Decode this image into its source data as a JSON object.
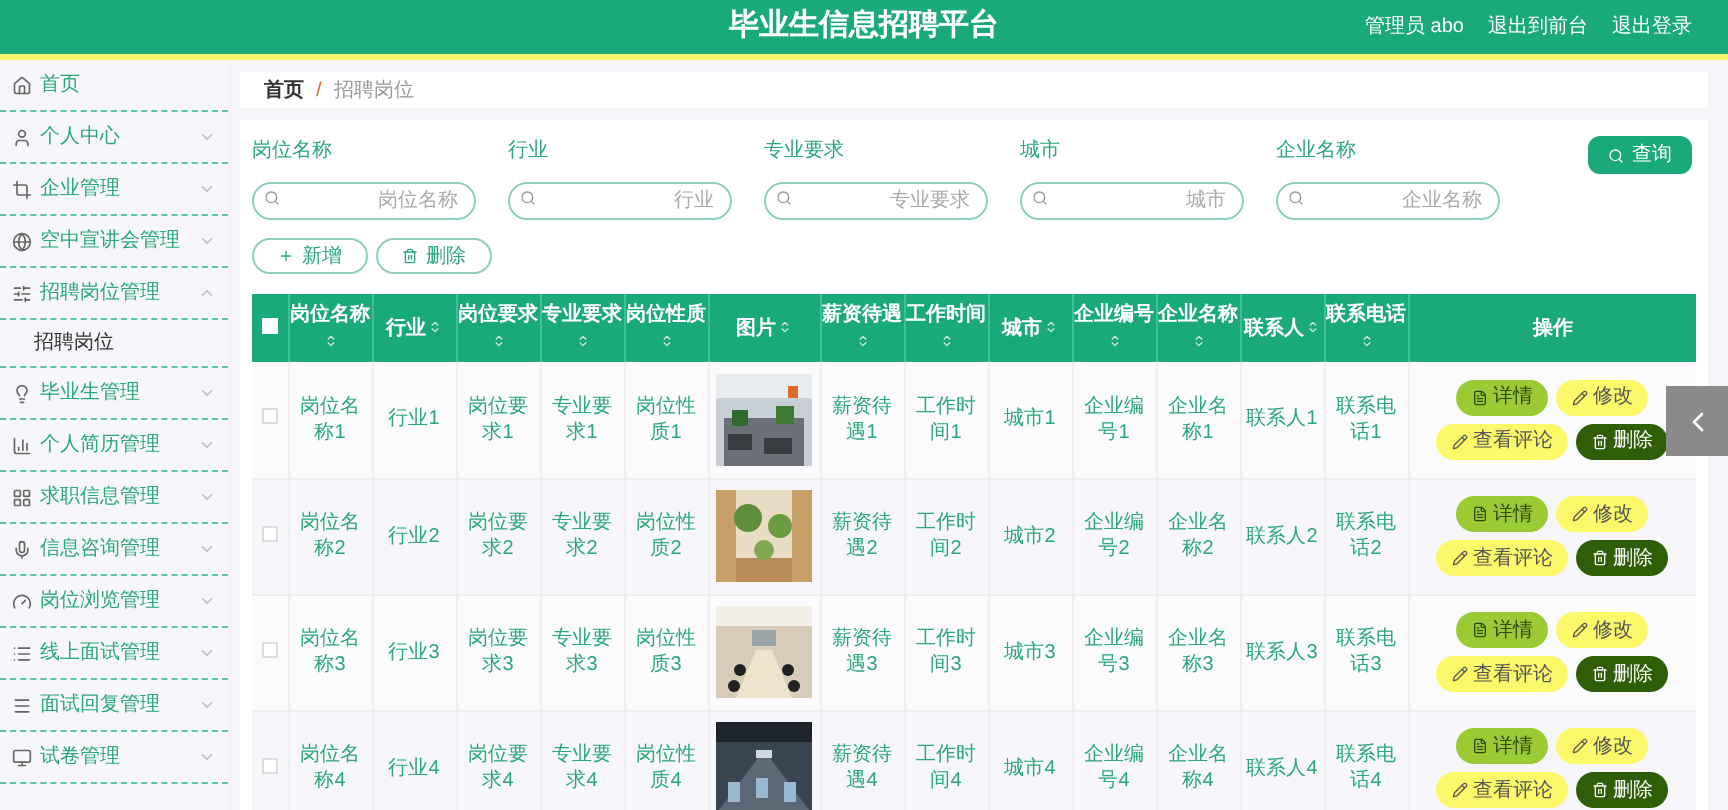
{
  "header": {
    "title": "毕业生信息招聘平台",
    "links": [
      "管理员 abo",
      "退出到前台",
      "退出登录"
    ]
  },
  "sidebar": {
    "items": [
      {
        "label": "首页",
        "kind": "link"
      },
      {
        "label": "个人中心",
        "kind": "menu",
        "expanded": false
      },
      {
        "label": "企业管理",
        "kind": "menu",
        "expanded": false
      },
      {
        "label": "空中宣讲会管理",
        "kind": "menu",
        "expanded": false
      },
      {
        "label": "招聘岗位管理",
        "kind": "menu",
        "expanded": true,
        "children": [
          {
            "label": "招聘岗位"
          }
        ]
      },
      {
        "label": "毕业生管理",
        "kind": "menu",
        "expanded": false
      },
      {
        "label": "个人简历管理",
        "kind": "menu",
        "expanded": false
      },
      {
        "label": "求职信息管理",
        "kind": "menu",
        "expanded": false
      },
      {
        "label": "信息咨询管理",
        "kind": "menu",
        "expanded": false
      },
      {
        "label": "岗位浏览管理",
        "kind": "menu",
        "expanded": false
      },
      {
        "label": "线上面试管理",
        "kind": "menu",
        "expanded": false
      },
      {
        "label": "面试回复管理",
        "kind": "menu",
        "expanded": false
      },
      {
        "label": "试卷管理",
        "kind": "menu",
        "expanded": false
      }
    ]
  },
  "breadcrumb": {
    "items": [
      "首页",
      "招聘岗位"
    ],
    "separator": "/"
  },
  "search": {
    "fields": [
      {
        "label": "岗位名称",
        "placeholder": "岗位名称"
      },
      {
        "label": "行业",
        "placeholder": "行业"
      },
      {
        "label": "专业要求",
        "placeholder": "专业要求"
      },
      {
        "label": "城市",
        "placeholder": "城市"
      },
      {
        "label": "企业名称",
        "placeholder": "企业名称"
      }
    ],
    "button": "查询"
  },
  "actions": [
    {
      "label": "新增",
      "kind": "add"
    },
    {
      "label": "删除",
      "kind": "delete"
    }
  ],
  "table": {
    "select_all_checked": false,
    "columns": [
      {
        "label": "岗位名称",
        "kind": "text"
      },
      {
        "label": "行业",
        "kind": "text"
      },
      {
        "label": "岗位要求",
        "kind": "text"
      },
      {
        "label": "专业要求",
        "kind": "text"
      },
      {
        "label": "岗位性质",
        "kind": "text"
      },
      {
        "label": "图片",
        "kind": "picture"
      },
      {
        "label": "薪资待遇",
        "kind": "text"
      },
      {
        "label": "工作时间",
        "kind": "text"
      },
      {
        "label": "城市",
        "kind": "text"
      },
      {
        "label": "企业编号",
        "kind": "text"
      },
      {
        "label": "企业名称",
        "kind": "text"
      },
      {
        "label": "联系人",
        "kind": "text"
      },
      {
        "label": "联系电话",
        "kind": "text"
      }
    ],
    "actions_header": "操作",
    "rows": [
      {
        "checked": false,
        "values": [
          "岗位名称1",
          "行业1",
          "岗位要求1",
          "专业要求1",
          "岗位性质1",
          "薪资待遇1",
          "工作时间1",
          "城市1",
          "企业编号1",
          "企业名称1",
          "联系人1",
          "联系电话1"
        ],
        "actions": [
          {
            "label": "详情",
            "kind": "detail"
          },
          {
            "label": "修改",
            "kind": "edit"
          },
          {
            "label": "查看评论",
            "kind": "comment"
          },
          {
            "label": "删除",
            "kind": "delete"
          }
        ]
      },
      {
        "checked": false,
        "values": [
          "岗位名称2",
          "行业2",
          "岗位要求2",
          "专业要求2",
          "岗位性质2",
          "薪资待遇2",
          "工作时间2",
          "城市2",
          "企业编号2",
          "企业名称2",
          "联系人2",
          "联系电话2"
        ],
        "actions": [
          {
            "label": "详情",
            "kind": "detail"
          },
          {
            "label": "修改",
            "kind": "edit"
          },
          {
            "label": "查看评论",
            "kind": "comment"
          },
          {
            "label": "删除",
            "kind": "delete"
          }
        ]
      },
      {
        "checked": false,
        "values": [
          "岗位名称3",
          "行业3",
          "岗位要求3",
          "专业要求3",
          "岗位性质3",
          "薪资待遇3",
          "工作时间3",
          "城市3",
          "企业编号3",
          "企业名称3",
          "联系人3",
          "联系电话3"
        ],
        "actions": [
          {
            "label": "详情",
            "kind": "detail"
          },
          {
            "label": "修改",
            "kind": "edit"
          },
          {
            "label": "查看评论",
            "kind": "comment"
          },
          {
            "label": "删除",
            "kind": "delete"
          }
        ]
      },
      {
        "checked": false,
        "values": [
          "岗位名称4",
          "行业4",
          "岗位要求4",
          "专业要求4",
          "岗位性质4",
          "薪资待遇4",
          "工作时间4",
          "城市4",
          "企业编号4",
          "企业名称4",
          "联系人4",
          "联系电话4"
        ],
        "actions": [
          {
            "label": "详情",
            "kind": "detail"
          },
          {
            "label": "修改",
            "kind": "edit"
          },
          {
            "label": "查看评论",
            "kind": "comment"
          },
          {
            "label": "删除",
            "kind": "delete"
          }
        ]
      }
    ]
  }
}
